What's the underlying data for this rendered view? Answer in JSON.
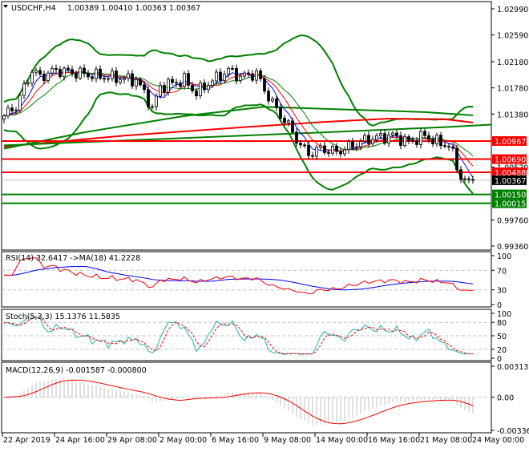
{
  "header": {
    "symbol_label": "USDCHF,H4",
    "ohlc": "1.00389 1.00410 1.00363 1.00367"
  },
  "colors": {
    "bull": "#000000",
    "bear": "#000000",
    "band": "#008000",
    "level_red": "#ff0000",
    "level_green": "#008000",
    "current": "#000000"
  },
  "chart_data": [
    {
      "type": "candlestick",
      "title": "USDCHF,H4",
      "ylim": [
        0.9936,
        1.0299
      ],
      "y_ticks": [
        "1.02990",
        "1.02590",
        "1.02180",
        "1.01780",
        "1.01380",
        "1.00570",
        "0.99760",
        "0.99360"
      ],
      "y_tick_values": [
        1.0299,
        1.0259,
        1.0218,
        1.0178,
        1.0138,
        1.0057,
        0.9976,
        0.9936
      ],
      "x_ticks": [
        "22 Apr 2019",
        "24 Apr 16:00",
        "29 Apr 08:00",
        "2 May 00:00",
        "6 May 16:00",
        "9 May 08:00",
        "14 May 00:00",
        "16 May 16:00",
        "21 May 08:00",
        "24 May 00:00"
      ],
      "x_tick_bars": [
        0,
        13,
        26,
        39,
        52,
        65,
        78,
        91,
        104,
        117
      ],
      "bar_count": 118,
      "close_anchors": [
        [
          0,
          1.0135
        ],
        [
          3,
          1.015
        ],
        [
          7,
          1.0205
        ],
        [
          9,
          1.0195
        ],
        [
          13,
          1.0205
        ],
        [
          19,
          1.02
        ],
        [
          25,
          1.0195
        ],
        [
          33,
          1.019
        ],
        [
          36,
          1.016
        ],
        [
          37,
          1.0145
        ],
        [
          39,
          1.018
        ],
        [
          45,
          1.019
        ],
        [
          48,
          1.017
        ],
        [
          51,
          1.0185
        ],
        [
          56,
          1.0205
        ],
        [
          59,
          1.0195
        ],
        [
          63,
          1.02
        ],
        [
          65,
          1.0175
        ],
        [
          68,
          1.0145
        ],
        [
          71,
          1.012
        ],
        [
          74,
          1.009
        ],
        [
          76,
          1.0077
        ],
        [
          79,
          1.0085
        ],
        [
          83,
          1.008
        ],
        [
          87,
          1.009
        ],
        [
          91,
          1.01
        ],
        [
          97,
          1.0105
        ],
        [
          101,
          1.0095
        ],
        [
          105,
          1.0105
        ],
        [
          108,
          1.0095
        ],
        [
          111,
          1.009
        ],
        [
          113,
          1.006
        ],
        [
          114,
          1.004
        ],
        [
          117,
          1.00367
        ]
      ],
      "moving_averages": [
        {
          "name": "ma-red-long",
          "color": "#ff0000",
          "points": [
            [
              0,
              1.0088
            ],
            [
              30,
              1.0105
            ],
            [
              60,
              1.0118
            ],
            [
              80,
              1.0126
            ],
            [
              96,
              1.0131
            ],
            [
              110,
              1.013
            ],
            [
              117,
              1.0125
            ]
          ]
        },
        {
          "name": "ma-green-long",
          "color": "#008000",
          "points": [
            [
              0,
              1.009
            ],
            [
              40,
              1.01
            ],
            [
              80,
              1.011
            ],
            [
              110,
              1.0118
            ],
            [
              122,
              1.0122
            ]
          ]
        },
        {
          "name": "ma-green-mid",
          "color": "#008000",
          "points": [
            [
              0,
              1.0085
            ],
            [
              20,
              1.011
            ],
            [
              45,
              1.0135
            ],
            [
              65,
              1.0149
            ],
            [
              85,
              1.0145
            ],
            [
              105,
              1.0141
            ],
            [
              117,
              1.0136
            ]
          ]
        }
      ],
      "levels": [
        {
          "value": 1.00967,
          "label": "1.00967",
          "color": "#ff0000"
        },
        {
          "value": 1.0069,
          "label": "1.00690",
          "color": "#ff0000"
        },
        {
          "value": 1.00488,
          "label": "1.00488",
          "color": "#ff0000"
        },
        {
          "value": 1.0015,
          "label": "1.00150",
          "color": "#008000"
        },
        {
          "value": 1.00015,
          "label": "1.00015",
          "color": "#008000"
        }
      ],
      "current_price": {
        "value": 1.00367,
        "label": "1.00367"
      }
    },
    {
      "type": "line",
      "name": "RSI",
      "label": "RSI(14) 32.6417  ->MA(18) 41.2228",
      "ylim": [
        0,
        100
      ],
      "y_ticks": [
        "100",
        "70",
        "30",
        "0"
      ],
      "y_tick_values": [
        100,
        70,
        30,
        0
      ],
      "series": [
        {
          "name": "RSI(14)",
          "color": "#ff0000",
          "last": 32.6417
        },
        {
          "name": "MA(18)",
          "color": "#0000ff",
          "last": 41.2228
        }
      ]
    },
    {
      "type": "line",
      "name": "Stochastic",
      "label": "Stoch(5,3,3) 15.1376 11.5835",
      "ylim": [
        0,
        100
      ],
      "y_ticks": [
        "100",
        "80",
        "50",
        "20",
        "0"
      ],
      "y_tick_values": [
        100,
        80,
        50,
        20,
        0
      ],
      "series": [
        {
          "name": "Main",
          "color": "#20b2aa",
          "last": 15.1376
        },
        {
          "name": "Signal",
          "color": "#ff0000",
          "last": 11.5835
        }
      ]
    },
    {
      "type": "bar",
      "name": "MACD",
      "label": "MACD(12,26,9) -0.001587 -0.000800",
      "ylim": [
        -0.003363,
        0.003133
      ],
      "y_ticks": [
        "0.003133",
        "0.00",
        "-0.003363"
      ],
      "y_tick_values": [
        0.003133,
        0,
        -0.003363
      ],
      "series": [
        {
          "name": "MACD",
          "color": "#c0c0c0",
          "last": -0.001587
        },
        {
          "name": "Signal",
          "color": "#ff0000",
          "last": -0.0008
        }
      ]
    }
  ]
}
